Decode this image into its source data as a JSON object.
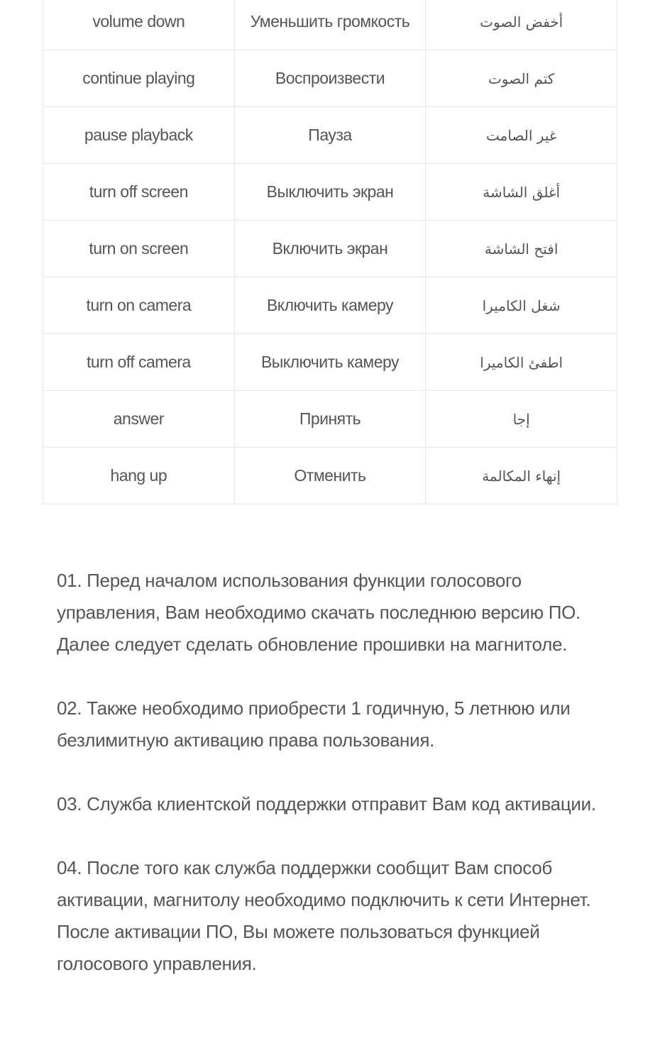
{
  "table": {
    "rows": [
      {
        "en": "volume down",
        "ru": "Уменьшить громкость",
        "ar": "أخفض الصوت"
      },
      {
        "en": "continue playing",
        "ru": "Воспроизвести",
        "ar": "كتم الصوت"
      },
      {
        "en": "pause playback",
        "ru": "Пауза",
        "ar": "غير الصامت"
      },
      {
        "en": "turn off screen",
        "ru": "Выключить экран",
        "ar": "أغلق الشاشة"
      },
      {
        "en": "turn on screen",
        "ru": "Включить экран",
        "ar": "افتح الشاشة"
      },
      {
        "en": "turn on camera",
        "ru": "Включить камеру",
        "ar": "شغل الكاميرا"
      },
      {
        "en": "turn off camera",
        "ru": "Выключить камеру",
        "ar": "اطفئ الكاميرا"
      },
      {
        "en": "answer",
        "ru": "Принять",
        "ar": "إجا"
      },
      {
        "en": "hang up",
        "ru": "Отменить",
        "ar": "إنهاء المكالمة"
      }
    ]
  },
  "notes": [
    "01. Перед началом использования функции голосового управления, Вам необходимо скачать последнюю версию ПО. Далее следует сделать обновление прошивки на магнитоле.",
    "02. Также необходимо приобрести 1 годичную, 5 летнюю или безлимитную активацию права пользования.",
    "03. Служба клиентской поддержки отправит Вам код активации.",
    "04. После того как служба поддержки сообщит Вам способ активации, магнитолу необходимо подключить к сети Интернет. После активации ПО, Вы можете пользоваться функцией голосового управления."
  ]
}
